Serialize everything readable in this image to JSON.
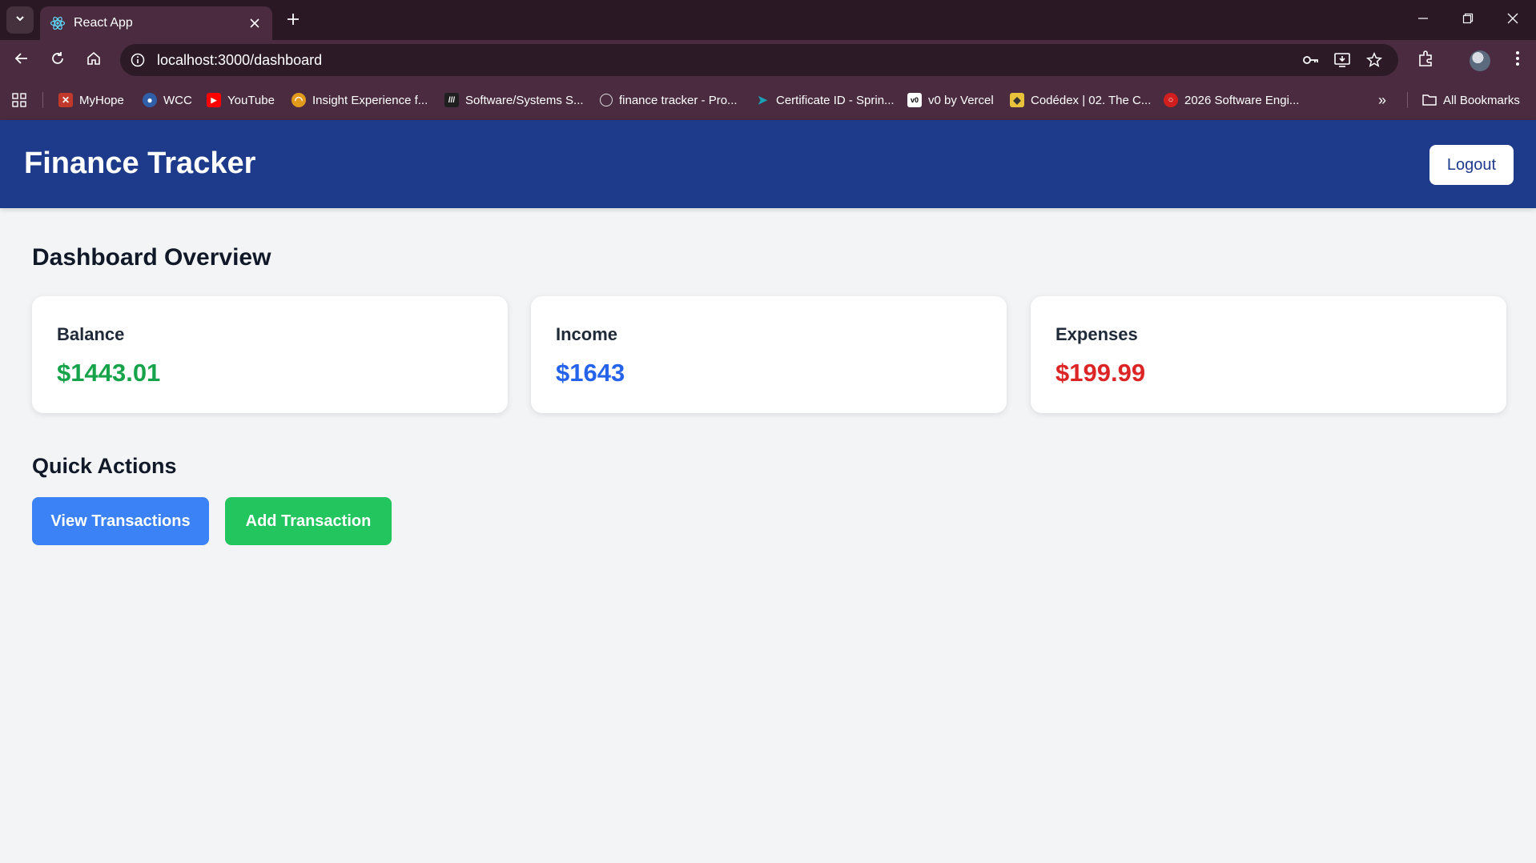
{
  "browser": {
    "tab_title": "React App",
    "url": "localhost:3000/dashboard",
    "bookmarks": [
      {
        "label": "MyHope",
        "color": "#c0392b"
      },
      {
        "label": "WCC",
        "color": "#2f5fa8"
      },
      {
        "label": "YouTube",
        "color": "#ff0000"
      },
      {
        "label": "Insight Experience f...",
        "color": "#e29a1c"
      },
      {
        "label": "Software/Systems S...",
        "color": "#1f1f1f"
      },
      {
        "label": "finance tracker - Pro...",
        "color": "#5e5e5e"
      },
      {
        "label": "Certificate ID - Sprin...",
        "color": "#1aa3b8"
      },
      {
        "label": "v0 by Vercel",
        "color": "#ffffff"
      },
      {
        "label": "Codédex | 02. The C...",
        "color": "#e7c23a"
      },
      {
        "label": "2026 Software Engi...",
        "color": "#d11f1f"
      }
    ],
    "all_bookmarks": "All Bookmarks"
  },
  "header": {
    "title": "Finance Tracker",
    "logout_label": "Logout"
  },
  "dashboard": {
    "title": "Dashboard Overview",
    "cards": [
      {
        "label": "Balance",
        "value": "$1443.01",
        "color": "#16a34a"
      },
      {
        "label": "Income",
        "value": "$1643",
        "color": "#2563eb"
      },
      {
        "label": "Expenses",
        "value": "$199.99",
        "color": "#dc2626"
      }
    ]
  },
  "quick_actions": {
    "title": "Quick Actions",
    "view_label": "View Transactions",
    "add_label": "Add Transaction",
    "view_color": "#3b82f6",
    "add_color": "#22c55e"
  }
}
